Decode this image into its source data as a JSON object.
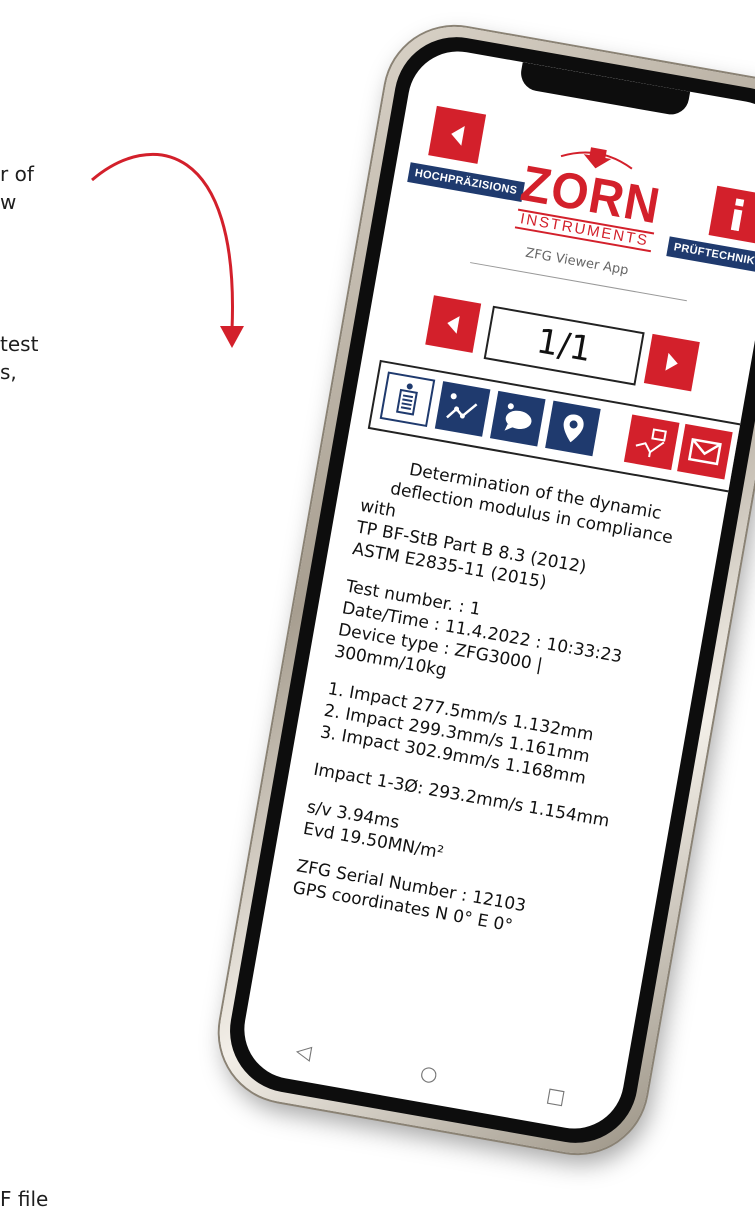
{
  "left_fragments": [
    "r of",
    "w",
    "test",
    "s,",
    "F file"
  ],
  "colors": {
    "brand_red": "#d3202b",
    "brand_navy": "#1f3a6e"
  },
  "app": {
    "banner_left": "HOCHPRÄZISIONS",
    "banner_right": "PRÜFTECHNIK",
    "logo_word": "ZORN",
    "logo_sub": "INSTRUMENTS",
    "title": "ZFG Viewer App",
    "page_indicator": "1/1"
  },
  "toolbar": {
    "icons": [
      "report-icon",
      "graph-icon",
      "comment-icon",
      "location-icon",
      "export-icon",
      "email-icon"
    ]
  },
  "report": {
    "heading": [
      "Determination of the dynamic",
      "deflection modulus in compliance",
      "with",
      "TP BF-StB Part B 8.3 (2012)",
      "ASTM E2835-11 (2015)"
    ],
    "test_number": "Test number. : 1",
    "date_time": "Date/Time : 11.4.2022 : 10:33:23",
    "device_type": "Device type : ZFG3000 |",
    "device_spec": "300mm/10kg",
    "impact1": "1. Impact 277.5mm/s 1.132mm",
    "impact2": "2. Impact 299.3mm/s 1.161mm",
    "impact3": "3. Impact 302.9mm/s 1.168mm",
    "impact_avg": "Impact 1-3Ø: 293.2mm/s 1.154mm",
    "sv": "s/v 3.94ms",
    "evd": "Evd 19.50MN/m²",
    "serial": "ZFG Serial Number : 12103",
    "gps": "GPS coordinates N 0° E 0°"
  },
  "navbar": {
    "back": "◁",
    "home": "○",
    "recent": "□"
  }
}
